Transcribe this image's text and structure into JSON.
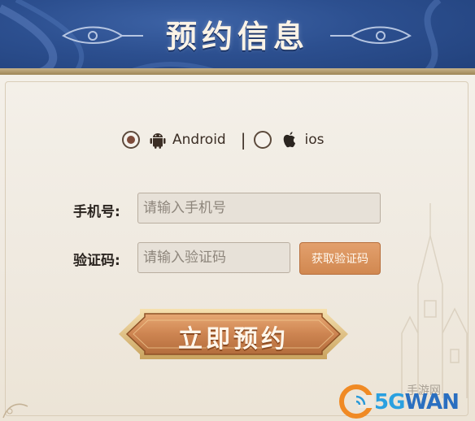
{
  "header": {
    "title": "预约信息"
  },
  "os": {
    "options": [
      {
        "label": "Android",
        "icon": "android-icon",
        "selected": true
      },
      {
        "label": "ios",
        "icon": "apple-icon",
        "selected": false
      }
    ],
    "separator": "|"
  },
  "form": {
    "phone_label": "手机号:",
    "phone_placeholder": "请输入手机号",
    "code_label": "验证码:",
    "code_placeholder": "请输入验证码",
    "get_code_button": "获取验证码"
  },
  "submit": {
    "label": "立即预约"
  },
  "watermark": {
    "brand_prefix": "5G",
    "brand_suffix": "WAN",
    "faint_text": "手游网"
  },
  "colors": {
    "header_blue": "#2c4f8f",
    "accent_orange": "#d18850",
    "panel_bg": "#efe9e0"
  }
}
